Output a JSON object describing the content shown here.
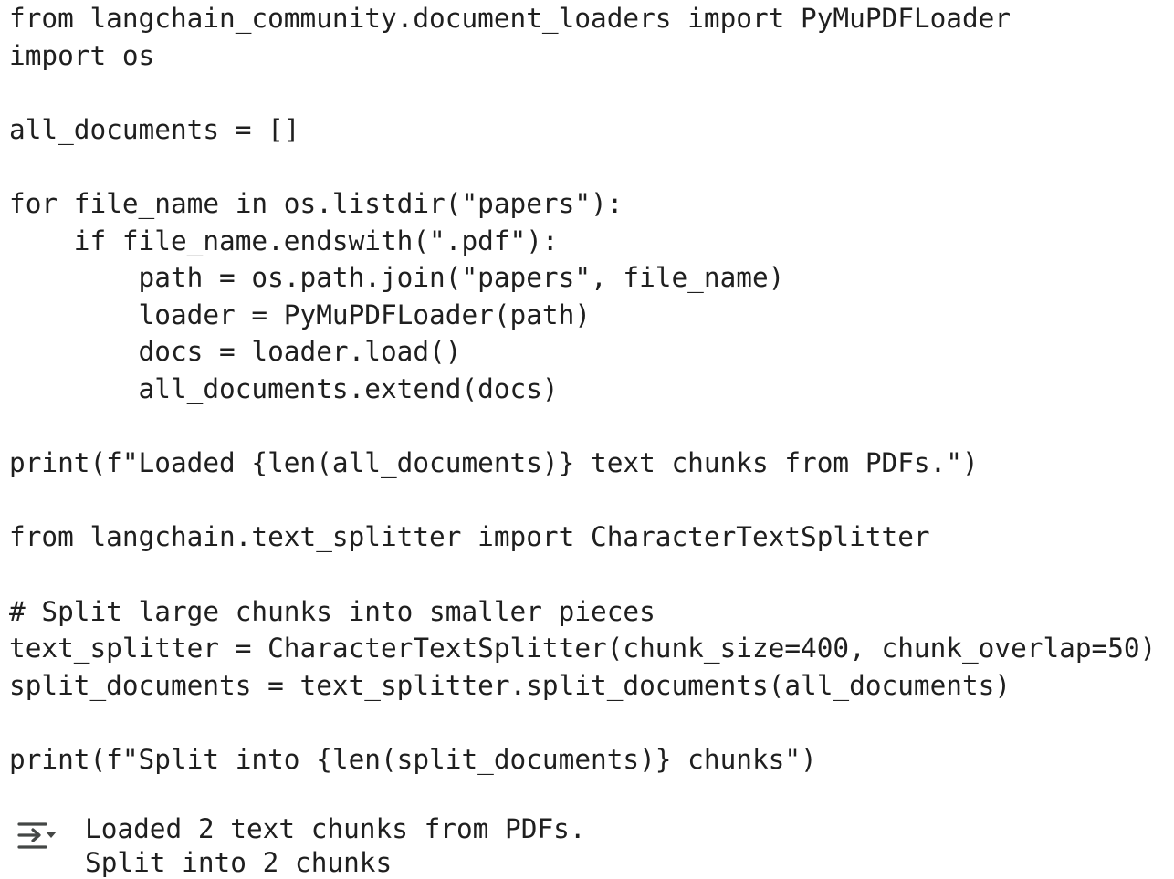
{
  "code_lines": [
    "from langchain_community.document_loaders import PyMuPDFLoader",
    "import os",
    "",
    "all_documents = []",
    "",
    "for file_name in os.listdir(\"papers\"):",
    "    if file_name.endswith(\".pdf\"):",
    "        path = os.path.join(\"papers\", file_name)",
    "        loader = PyMuPDFLoader(path)",
    "        docs = loader.load()",
    "        all_documents.extend(docs)",
    "",
    "print(f\"Loaded {len(all_documents)} text chunks from PDFs.\")",
    "",
    "from langchain.text_splitter import CharacterTextSplitter",
    "",
    "# Split large chunks into smaller pieces",
    "text_splitter = CharacterTextSplitter(chunk_size=400, chunk_overlap=50)",
    "split_documents = text_splitter.split_documents(all_documents)",
    "",
    "print(f\"Split into {len(split_documents)} chunks\")"
  ],
  "output": {
    "icon": "output-actions-icon",
    "lines": [
      "Loaded 2 text chunks from PDFs.",
      "Split into 2 chunks"
    ]
  },
  "colors": {
    "text": "#1f1f1f",
    "icon": "#444746",
    "background": "#ffffff"
  }
}
